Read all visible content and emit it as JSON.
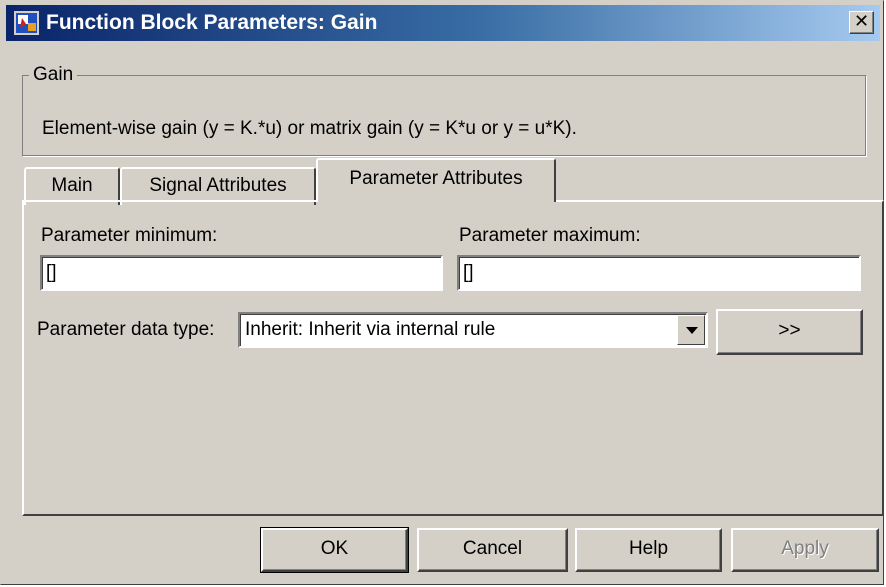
{
  "window": {
    "title": "Function Block Parameters: Gain",
    "icon": "simulink-block-icon",
    "close_glyph": "✕"
  },
  "group": {
    "legend": "Gain",
    "description": "Element-wise gain (y = K.*u) or matrix gain (y = K*u or y = u*K)."
  },
  "tabs": [
    {
      "label": "Main",
      "active": false
    },
    {
      "label": "Signal Attributes",
      "active": false
    },
    {
      "label": "Parameter Attributes",
      "active": true
    }
  ],
  "params": {
    "min_label": "Parameter minimum:",
    "min_value": "[]",
    "max_label": "Parameter maximum:",
    "max_value": "[]",
    "datatype_label": "Parameter data type:",
    "datatype_value": "Inherit: Inherit via internal rule",
    "assistant_label": ">>"
  },
  "buttons": {
    "ok": "OK",
    "cancel": "Cancel",
    "help": "Help",
    "apply": "Apply",
    "apply_enabled": false
  }
}
